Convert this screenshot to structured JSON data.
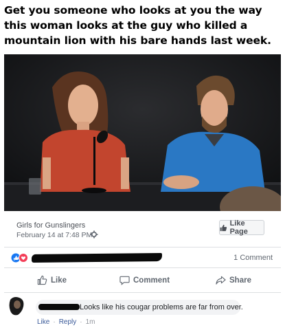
{
  "meme": {
    "caption": "Get you someone who looks at you the way this woman looks at the guy who killed a mountain lion with his bare hands last week."
  },
  "post": {
    "page_name": "Girls for Gunslingers",
    "date": "February 14 at 7:48 PM ·",
    "like_page_label": "Like Page"
  },
  "reactions": {
    "icons": [
      "like-reaction-icon",
      "love-reaction-icon"
    ],
    "comment_count": "1 Comment"
  },
  "actions": {
    "like_label": "Like",
    "comment_label": "Comment",
    "share_label": "Share"
  },
  "comment": {
    "text": "Looks like his cougar problems are far from over.",
    "like_label": "Like",
    "reply_label": "Reply",
    "time": "1m"
  },
  "colors": {
    "link": "#385898",
    "like_blue": "#1877f2",
    "love_red": "#f33e58",
    "shirt_red": "#c2452e",
    "jacket_blue": "#2a78c4"
  }
}
